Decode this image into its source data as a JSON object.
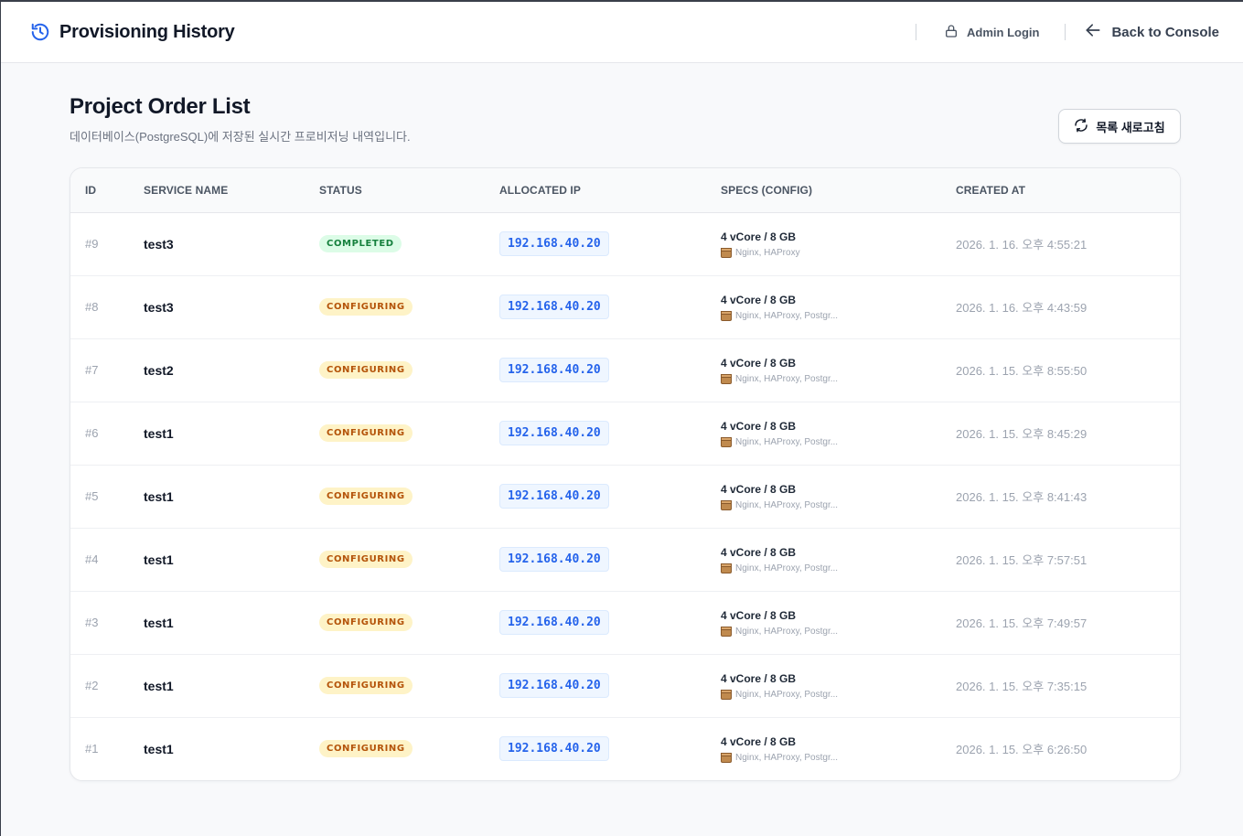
{
  "header": {
    "title": "Provisioning History",
    "admin_login": "Admin Login",
    "back_to_console": "Back to Console"
  },
  "page": {
    "title": "Project Order List",
    "subtitle": "데이터베이스(PostgreSQL)에 저장된 실시간 프로비저닝 내역입니다.",
    "refresh_label": "목록 새로고침"
  },
  "table": {
    "headers": {
      "id": "ID",
      "service_name": "SERVICE NAME",
      "status": "STATUS",
      "allocated_ip": "ALLOCATED IP",
      "specs": "SPECS (CONFIG)",
      "created_at": "CREATED AT"
    },
    "rows": [
      {
        "id": "#9",
        "name": "test3",
        "status": "COMPLETED",
        "ip": "192.168.40.20",
        "spec": "4 vCore / 8 GB",
        "packages": "Nginx, HAProxy",
        "created": "2026. 1. 16. 오후 4:55:21"
      },
      {
        "id": "#8",
        "name": "test3",
        "status": "CONFIGURING",
        "ip": "192.168.40.20",
        "spec": "4 vCore / 8 GB",
        "packages": "Nginx, HAProxy, Postgr...",
        "created": "2026. 1. 16. 오후 4:43:59"
      },
      {
        "id": "#7",
        "name": "test2",
        "status": "CONFIGURING",
        "ip": "192.168.40.20",
        "spec": "4 vCore / 8 GB",
        "packages": "Nginx, HAProxy, Postgr...",
        "created": "2026. 1. 15. 오후 8:55:50"
      },
      {
        "id": "#6",
        "name": "test1",
        "status": "CONFIGURING",
        "ip": "192.168.40.20",
        "spec": "4 vCore / 8 GB",
        "packages": "Nginx, HAProxy, Postgr...",
        "created": "2026. 1. 15. 오후 8:45:29"
      },
      {
        "id": "#5",
        "name": "test1",
        "status": "CONFIGURING",
        "ip": "192.168.40.20",
        "spec": "4 vCore / 8 GB",
        "packages": "Nginx, HAProxy, Postgr...",
        "created": "2026. 1. 15. 오후 8:41:43"
      },
      {
        "id": "#4",
        "name": "test1",
        "status": "CONFIGURING",
        "ip": "192.168.40.20",
        "spec": "4 vCore / 8 GB",
        "packages": "Nginx, HAProxy, Postgr...",
        "created": "2026. 1. 15. 오후 7:57:51"
      },
      {
        "id": "#3",
        "name": "test1",
        "status": "CONFIGURING",
        "ip": "192.168.40.20",
        "spec": "4 vCore / 8 GB",
        "packages": "Nginx, HAProxy, Postgr...",
        "created": "2026. 1. 15. 오후 7:49:57"
      },
      {
        "id": "#2",
        "name": "test1",
        "status": "CONFIGURING",
        "ip": "192.168.40.20",
        "spec": "4 vCore / 8 GB",
        "packages": "Nginx, HAProxy, Postgr...",
        "created": "2026. 1. 15. 오후 7:35:15"
      },
      {
        "id": "#1",
        "name": "test1",
        "status": "CONFIGURING",
        "ip": "192.168.40.20",
        "spec": "4 vCore / 8 GB",
        "packages": "Nginx, HAProxy, Postgr...",
        "created": "2026. 1. 15. 오후 6:26:50"
      }
    ]
  },
  "icons": {
    "brand": "history-icon",
    "admin": "lock-icon",
    "back": "arrow-left-icon",
    "refresh": "refresh-icon",
    "package": "package-icon"
  },
  "colors": {
    "accent": "#2563eb",
    "completed_bg": "#dcfce7",
    "completed_text": "#15803d",
    "configuring_bg": "#fef3c7",
    "configuring_text": "#b45309"
  }
}
